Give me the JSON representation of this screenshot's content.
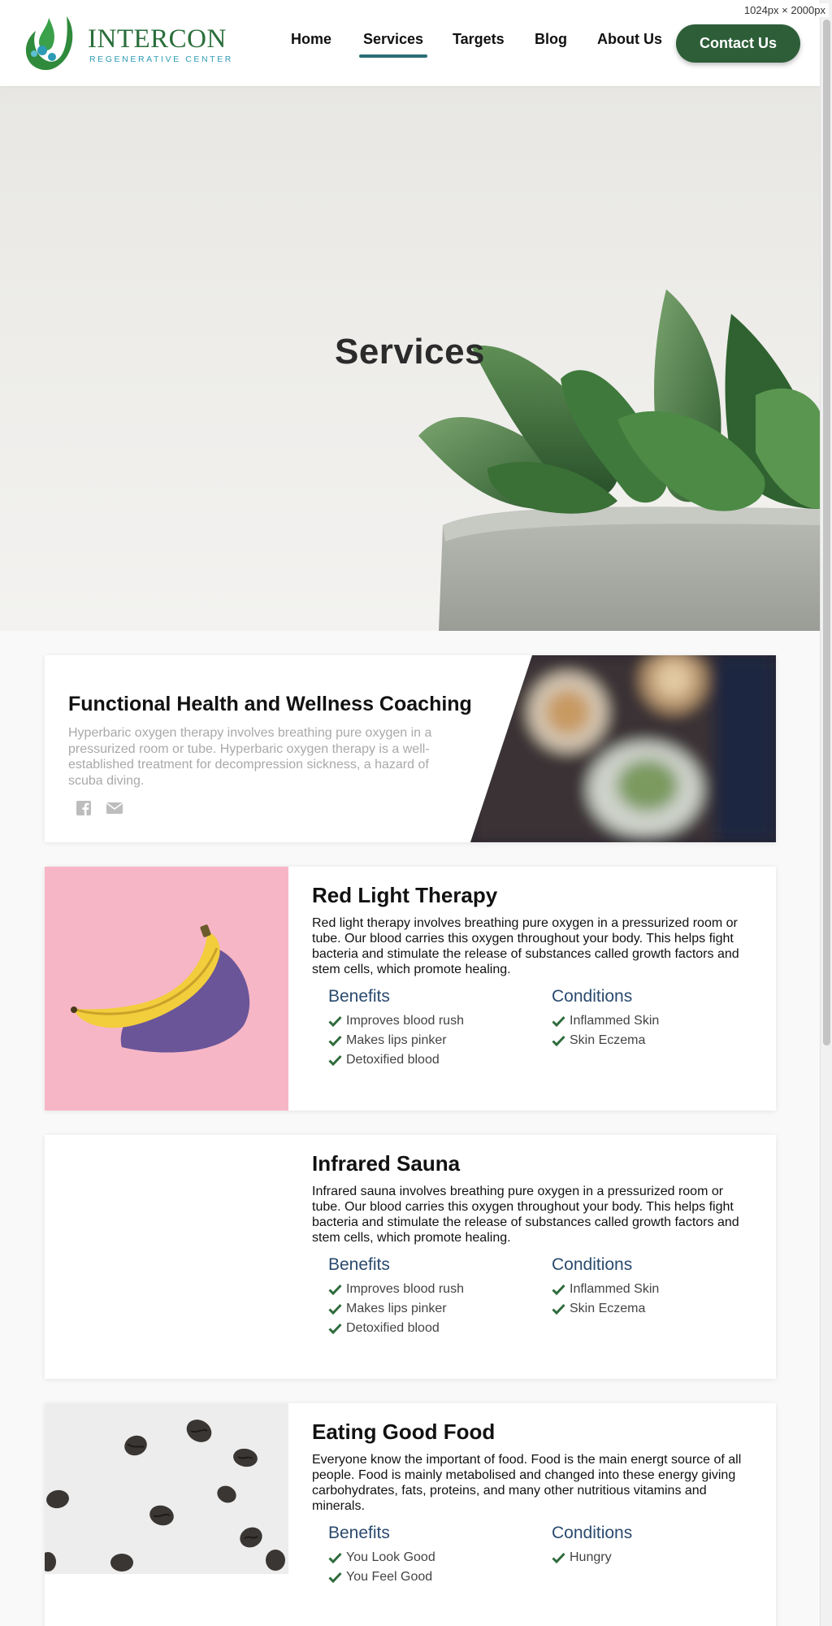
{
  "viewport_badge": "1024px × 2000px",
  "header": {
    "logo": {
      "name": "INTERCON",
      "tagline": "REGENERATIVE CENTER"
    },
    "nav": [
      {
        "label": "Home",
        "active": false
      },
      {
        "label": "Services",
        "active": true
      },
      {
        "label": "Targets",
        "active": false
      },
      {
        "label": "Blog",
        "active": false
      },
      {
        "label": "About Us",
        "active": false
      }
    ],
    "contact_label": "Contact Us"
  },
  "hero": {
    "title": "Services"
  },
  "intro": {
    "title": "Functional Health and Wellness Coaching",
    "description": "Hyperbaric oxygen therapy involves breathing pure oxygen in a pressurized room or tube. Hyperbaric oxygen therapy is a well-established treatment for decompression sickness, a hazard of scuba diving.",
    "social": [
      "facebook-icon",
      "envelope-icon"
    ]
  },
  "services": [
    {
      "title": "Red Light Therapy",
      "description": "Red light therapy involves breathing pure oxygen in a pressurized room or tube. Our blood carries this oxygen throughout your body. This helps fight bacteria and stimulate the release of substances called growth factors and stem cells, which promote healing.",
      "benefits_label": "Benefits",
      "benefits": [
        "Improves blood rush",
        "Makes lips pinker",
        "Detoxified blood"
      ],
      "conditions_label": "Conditions",
      "conditions": [
        "Inflammed Skin",
        "Skin Eczema"
      ],
      "image": "banana-photo"
    },
    {
      "title": "Infrared Sauna",
      "description": "Infrared sauna involves breathing pure oxygen in a pressurized room or tube. Our blood carries this oxygen throughout your body. This helps fight bacteria and stimulate the release of substances called growth factors and stem cells, which promote healing.",
      "benefits_label": "Benefits",
      "benefits": [
        "Improves blood rush",
        "Makes lips pinker",
        "Detoxified blood"
      ],
      "conditions_label": "Conditions",
      "conditions": [
        "Inflammed Skin",
        "Skin Eczema"
      ],
      "image": ""
    },
    {
      "title": "Eating Good Food",
      "description": "Everyone know the important of food. Food is the main energt source of all people. Food is mainly metabolised and changed into these energy giving carbohydrates, fats, proteins, and many other nutritious vitamins and minerals.",
      "benefits_label": "Benefits",
      "benefits": [
        "You Look Good",
        "You Feel Good"
      ],
      "conditions_label": "Conditions",
      "conditions": [
        "Hungry"
      ],
      "image": "coffee-beans-photo"
    }
  ],
  "colors": {
    "brand_green": "#2d5e38",
    "check_green": "#2f6b3c",
    "heading_blue": "#2a4a6e",
    "nav_underline": "#2a6e76"
  }
}
